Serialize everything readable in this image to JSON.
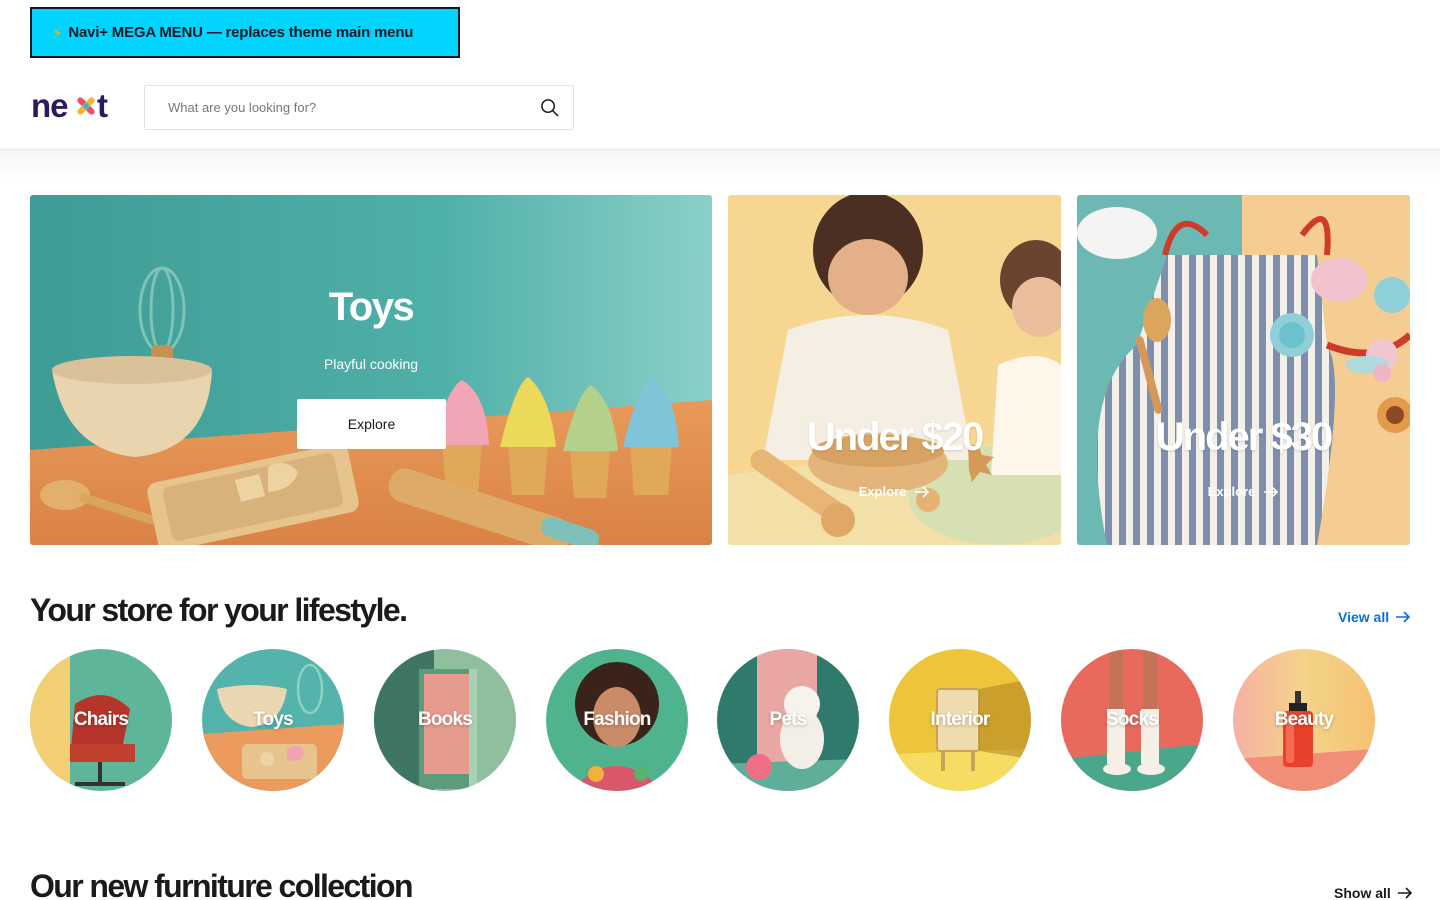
{
  "mega_banner": {
    "icon": "lightning-bolt-icon",
    "text": "Navi+ MEGA MENU — replaces theme main menu"
  },
  "header": {
    "logo_text": "next",
    "search_placeholder": "What are you looking for?"
  },
  "hero": {
    "main": {
      "title": "Toys",
      "subtitle": "Playful cooking",
      "button": "Explore"
    },
    "cards": [
      {
        "title": "Under $20",
        "link": "Explore"
      },
      {
        "title": "Under $30",
        "link": "Explore"
      }
    ]
  },
  "lifestyle": {
    "title": "Your store for your lifestyle.",
    "view_all": "View all",
    "categories": [
      {
        "label": "Chairs"
      },
      {
        "label": "Toys"
      },
      {
        "label": "Books"
      },
      {
        "label": "Fashion"
      },
      {
        "label": "Pets"
      },
      {
        "label": "Interior"
      },
      {
        "label": "Socks"
      },
      {
        "label": "Beauty"
      }
    ]
  },
  "furniture": {
    "title": "Our new furniture collection",
    "show_all": "Show all"
  },
  "colors": {
    "accent": "#0a6fd6",
    "banner": "#00d4ff",
    "logo_dark": "#2b1a5e"
  }
}
